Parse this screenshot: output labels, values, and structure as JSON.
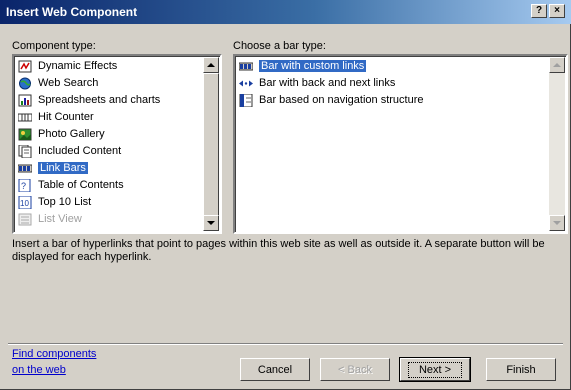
{
  "window": {
    "title": "Insert Web Component",
    "help_glyph": "?",
    "close_glyph": "×"
  },
  "component_type": {
    "label": "Component type:",
    "items": [
      {
        "label": "Dynamic Effects",
        "icon": "dynamic-effects-icon"
      },
      {
        "label": "Web Search",
        "icon": "web-search-icon"
      },
      {
        "label": "Spreadsheets and charts",
        "icon": "spreadsheet-chart-icon"
      },
      {
        "label": "Hit Counter",
        "icon": "hit-counter-icon"
      },
      {
        "label": "Photo Gallery",
        "icon": "photo-gallery-icon"
      },
      {
        "label": "Included Content",
        "icon": "included-content-icon"
      },
      {
        "label": "Link Bars",
        "icon": "link-bars-icon",
        "selected": true
      },
      {
        "label": "Table of Contents",
        "icon": "table-of-contents-icon"
      },
      {
        "label": "Top 10 List",
        "icon": "top10-list-icon"
      },
      {
        "label": "List View",
        "icon": "list-view-icon",
        "disabled": true
      }
    ]
  },
  "bar_type": {
    "label": "Choose a bar type:",
    "items": [
      {
        "label": "Bar with custom links",
        "icon": "custom-links-bar-icon",
        "selected": true
      },
      {
        "label": "Bar with back and next links",
        "icon": "back-next-links-icon"
      },
      {
        "label": "Bar based on navigation structure",
        "icon": "navigation-structure-icon"
      }
    ]
  },
  "description": "Insert a bar of hyperlinks that point to pages within this web site as well as outside it.  A separate button will be displayed for each hyperlink.",
  "find_link": {
    "line1": "Find components",
    "line2": "on the web"
  },
  "buttons": {
    "cancel": "Cancel",
    "back": "< Back",
    "next": "Next >",
    "finish": "Finish"
  },
  "colors": {
    "selection": "#316ac5",
    "titlebar_start": "#0a246a",
    "link": "#0000cc",
    "dialog_face": "#d4d0c8"
  }
}
